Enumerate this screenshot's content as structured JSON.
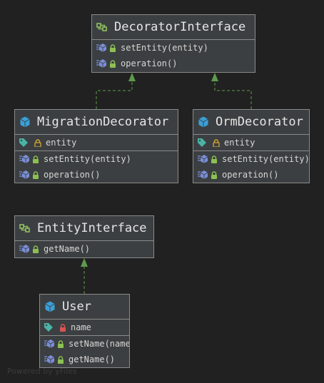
{
  "watermark": "Powered by yFiles",
  "nodes": {
    "decorator_interface": {
      "kind": "interface",
      "name": "DecoratorInterface",
      "fields": [],
      "methods": [
        {
          "name": "setEntity(entity)",
          "visibility": "public"
        },
        {
          "name": "operation()",
          "visibility": "public"
        }
      ]
    },
    "migration_decorator": {
      "kind": "class",
      "name": "MigrationDecorator",
      "fields": [
        {
          "name": "entity",
          "visibility": "protected"
        }
      ],
      "methods": [
        {
          "name": "setEntity(entity)",
          "visibility": "public"
        },
        {
          "name": "operation()",
          "visibility": "public"
        }
      ]
    },
    "orm_decorator": {
      "kind": "class",
      "name": "OrmDecorator",
      "fields": [
        {
          "name": "entity",
          "visibility": "protected"
        }
      ],
      "methods": [
        {
          "name": "setEntity(entity)",
          "visibility": "public"
        },
        {
          "name": "operation()",
          "visibility": "public"
        }
      ]
    },
    "entity_interface": {
      "kind": "interface",
      "name": "EntityInterface",
      "fields": [],
      "methods": [
        {
          "name": "getName()",
          "visibility": "public"
        }
      ]
    },
    "user": {
      "kind": "class",
      "name": "User",
      "fields": [
        {
          "name": "name",
          "visibility": "private"
        }
      ],
      "methods": [
        {
          "name": "setName(name)",
          "visibility": "public"
        },
        {
          "name": "getName()",
          "visibility": "public"
        }
      ]
    }
  },
  "edges": [
    {
      "from": "MigrationDecorator",
      "to": "DecoratorInterface",
      "type": "implements"
    },
    {
      "from": "OrmDecorator",
      "to": "DecoratorInterface",
      "type": "implements"
    },
    {
      "from": "User",
      "to": "EntityInterface",
      "type": "implements"
    }
  ],
  "colors": {
    "background": "#212121",
    "node_fill": "#3c3f41",
    "border": "#8a8a8a",
    "edge": "#5f9a4c",
    "class_icon": "#3aa0d8",
    "interface_icon": "#8fc060",
    "lock_public": "#8cc152",
    "lock_protected": "#d6a632",
    "lock_private": "#d85555",
    "tag": "#4bb3a5"
  }
}
